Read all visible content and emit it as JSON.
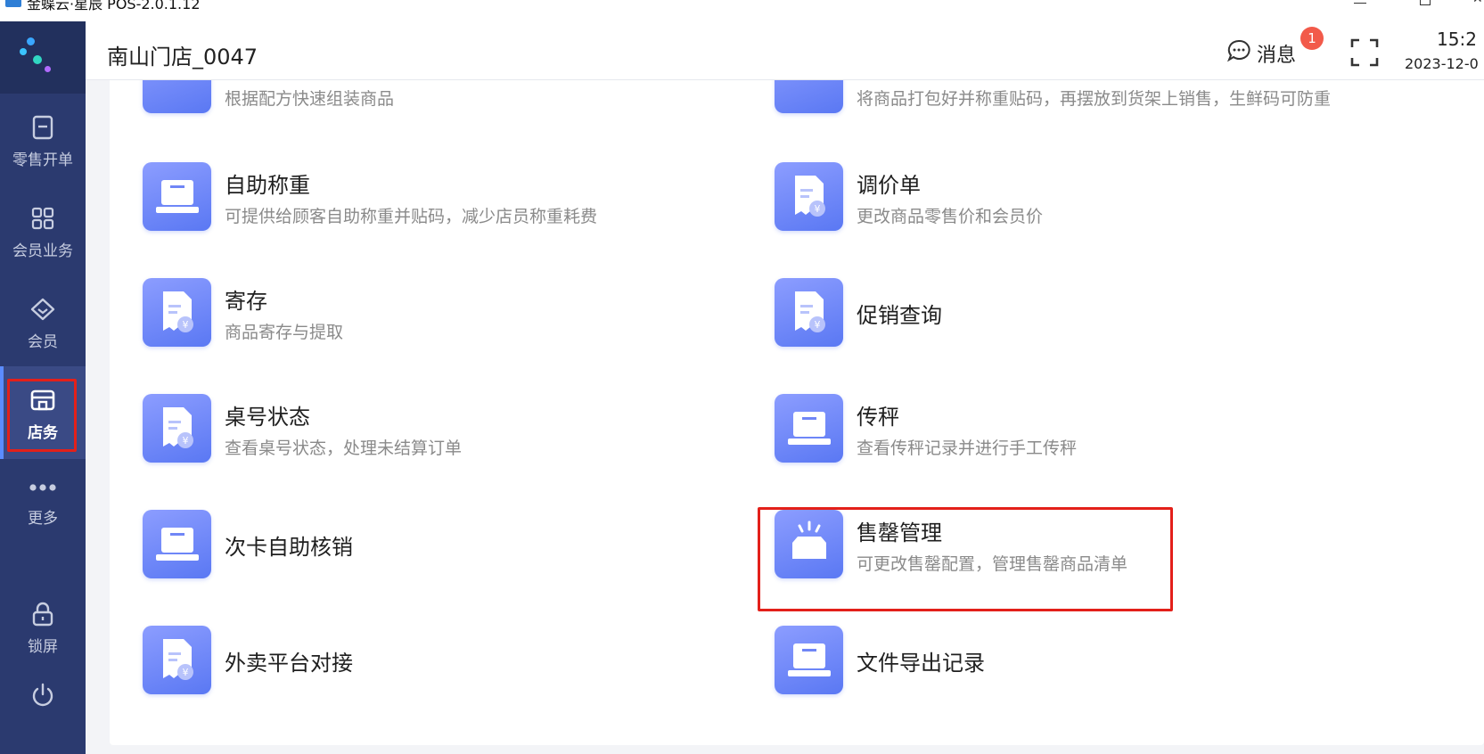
{
  "window": {
    "title": "金蝶云·星辰 POS-2.0.1.12"
  },
  "sidebar": {
    "items": [
      {
        "label": "零售开单",
        "icon": "receipt-icon",
        "active": false
      },
      {
        "label": "会员业务",
        "icon": "grid-icon",
        "active": false
      },
      {
        "label": "会员",
        "icon": "diamond-icon",
        "active": false
      },
      {
        "label": "店务",
        "icon": "store-icon",
        "active": true
      },
      {
        "label": "更多",
        "icon": "more-dots-icon",
        "active": false
      },
      {
        "label": "锁屏",
        "icon": "lock-icon",
        "active": false
      },
      {
        "label": "",
        "icon": "power-icon",
        "active": false
      }
    ]
  },
  "header": {
    "store_name": "南山门店_0047",
    "messages_label": "消息",
    "messages_badge": "1",
    "time": "15:2",
    "date": "2023-12-0"
  },
  "main": {
    "cards": [
      {
        "title": "",
        "desc": "根据配方快速组装商品",
        "icon": "scale-icon"
      },
      {
        "title": "",
        "desc": "将商品打包好并称重贴码，再摆放到货架上销售，生鲜码可防重",
        "icon": "scale-icon"
      },
      {
        "title": "自助称重",
        "desc": "可提供给顾客自助称重并贴码，减少店员称重耗费",
        "icon": "scale-icon"
      },
      {
        "title": "调价单",
        "desc": "更改商品零售价和会员价",
        "icon": "receipt-yuan-icon"
      },
      {
        "title": "寄存",
        "desc": "商品寄存与提取",
        "icon": "receipt-yuan-icon"
      },
      {
        "title": "促销查询",
        "desc": "",
        "icon": "receipt-yuan-icon"
      },
      {
        "title": "桌号状态",
        "desc": "查看桌号状态，处理未结算订单",
        "icon": "receipt-yuan-icon"
      },
      {
        "title": "传秤",
        "desc": "查看传秤记录并进行手工传秤",
        "icon": "scale-icon"
      },
      {
        "title": "次卡自助核销",
        "desc": "",
        "icon": "scale-icon"
      },
      {
        "title": "售罄管理",
        "desc": "可更改售罄配置，管理售罄商品清单",
        "icon": "sold-out-box-icon"
      },
      {
        "title": "外卖平台对接",
        "desc": "",
        "icon": "receipt-yuan-icon"
      },
      {
        "title": "文件导出记录",
        "desc": "",
        "icon": "scale-icon"
      }
    ]
  }
}
